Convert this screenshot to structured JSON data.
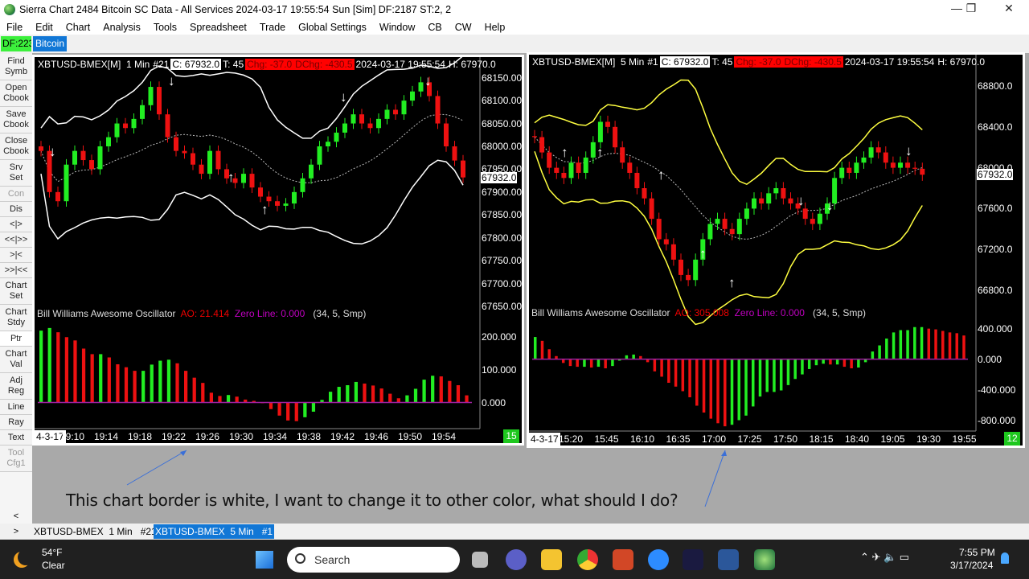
{
  "window": {
    "title": "Sierra Chart 2484 Bitcoin  SC Data - All Services 2024-03-17  19:55:54 Sun [Sim]  DF:2187  ST:2, 2",
    "minimize": "—",
    "restore": "❐",
    "close": "✕"
  },
  "menu": [
    "File",
    "Edit",
    "Chart",
    "Analysis",
    "Tools",
    "Spreadsheet",
    "Trade",
    "Global Settings",
    "Window",
    "CB",
    "CW",
    "Help"
  ],
  "tabs_row": {
    "df": "DF:223",
    "page": "Bitcoin"
  },
  "toolbar": [
    {
      "l1": "Find",
      "l2": "Symb"
    },
    {
      "l1": "Open",
      "l2": "Cbook"
    },
    {
      "l1": "Save",
      "l2": "Cbook"
    },
    {
      "l1": "Close",
      "l2": "Cbook"
    },
    {
      "l1": "Srv",
      "l2": "Set"
    },
    {
      "l1": "Con",
      "l2": ""
    },
    {
      "l1": "Dis",
      "l2": ""
    },
    {
      "l1": "<|>",
      "l2": ""
    },
    {
      "l1": "<<|>>",
      "l2": ""
    },
    {
      "l1": ">|<",
      "l2": ""
    },
    {
      "l1": ">>|<<",
      "l2": ""
    },
    {
      "l1": "Chart",
      "l2": "Set"
    },
    {
      "l1": "Chart",
      "l2": "Stdy"
    },
    {
      "l1": "Ptr",
      "l2": ""
    },
    {
      "l1": "Chart",
      "l2": "Val"
    },
    {
      "l1": "Adj",
      "l2": "Reg"
    },
    {
      "l1": "Line",
      "l2": ""
    },
    {
      "l1": "Ray",
      "l2": ""
    },
    {
      "l1": "Text",
      "l2": ""
    },
    {
      "l1": "Tool",
      "l2": "Cfg1"
    },
    {
      "l1": "<",
      "l2": ""
    },
    {
      "l1": ">",
      "l2": ""
    }
  ],
  "charts": [
    {
      "symbol": "XBTUSD-BMEX[M]  1 Min",
      "num": "#21",
      "close": "C: 67932.0",
      "ticks": "T: 45",
      "chg": "Chg: -37.0",
      "dchg": "DChg: -430.5",
      "datetime": "2024-03-17 19:55:54",
      "high": "H: 67970.0",
      "price_labels": [
        "68150.00",
        "68100.00",
        "68050.00",
        "68000.00",
        "67950.00",
        "67900.00",
        "67850.00",
        "67800.00",
        "67750.00",
        "67700.00",
        "67650.00"
      ],
      "price_ticks": [
        68150,
        68100,
        68050,
        68000,
        67950,
        67900,
        67850,
        67800,
        67750,
        67700,
        67650
      ],
      "price_range": [
        67650,
        68160
      ],
      "last_price": "67932.0",
      "band_color": "#ffffff",
      "closes": [
        67990,
        67900,
        67880,
        67960,
        67990,
        67970,
        67950,
        68000,
        68020,
        68050,
        68040,
        68060,
        68090,
        68130,
        68070,
        68020,
        67990,
        67985,
        67960,
        67940,
        67990,
        67950,
        67930,
        67920,
        67940,
        67910,
        67890,
        67880,
        67870,
        67875,
        67900,
        67930,
        67960,
        68000,
        68010,
        68030,
        68050,
        68070,
        68050,
        68040,
        68060,
        68080,
        68070,
        68100,
        68120,
        68140,
        68110,
        68050,
        68000,
        67969,
        67932
      ],
      "study": {
        "name": "Bill Williams Awesome Oscillator",
        "ao": "AO: 21.414",
        "zero": "Zero Line: 0.000",
        "params": "(34, 5, Smp)",
        "labels": [
          "200.000",
          "100.000",
          "0.000"
        ],
        "ticks": [
          200,
          100,
          0
        ],
        "range": [
          -70,
          240
        ],
        "values": [
          220,
          228,
          215,
          200,
          190,
          165,
          148,
          148,
          138,
          117,
          108,
          97,
          97,
          116,
          128,
          131,
          120,
          97,
          76,
          60,
          30,
          20,
          23,
          18,
          9,
          5,
          -2,
          -20,
          -40,
          -55,
          -57,
          -45,
          -28,
          8,
          33,
          48,
          53,
          63,
          58,
          52,
          43,
          27,
          13,
          22,
          42,
          70,
          82,
          80,
          66,
          53,
          22
        ]
      },
      "time_labels": [
        "19:10",
        "19:14",
        "19:18",
        "19:22",
        "19:26",
        "19:30",
        "19:34",
        "19:38",
        "19:42",
        "19:46",
        "19:50",
        "19:54"
      ],
      "date_label": "4-3-17",
      "badge": "15"
    },
    {
      "symbol": "XBTUSD-BMEX[M]  5 Min",
      "num": "#1",
      "close": "C: 67932.0",
      "ticks": "T: 45",
      "chg": "Chg: -37.0",
      "dchg": "DChg: -430.5",
      "datetime": "2024-03-17 19:55:54",
      "high": "H: 67970.0",
      "price_labels": [
        "68800.0",
        "68400.0",
        "68000.0",
        "67600.0",
        "67200.0",
        "66800.0"
      ],
      "price_ticks": [
        68800,
        68400,
        68000,
        67600,
        67200,
        66800
      ],
      "price_range": [
        66650,
        68950
      ],
      "last_price": "67932.0",
      "band_color": "#ffff40",
      "closes": [
        68300,
        68150,
        68000,
        67950,
        67900,
        68050,
        67950,
        68100,
        68250,
        68450,
        68400,
        68200,
        68050,
        67950,
        67800,
        67700,
        67500,
        67300,
        67250,
        67100,
        66950,
        66900,
        67100,
        67300,
        67450,
        67500,
        67400,
        67350,
        67500,
        67600,
        67700,
        67650,
        67750,
        67800,
        67700,
        67650,
        67600,
        67500,
        67450,
        67550,
        67650,
        67900,
        68000,
        67950,
        68050,
        68100,
        68200,
        68150,
        68050,
        68000,
        68050,
        68000,
        67990,
        67932
      ],
      "study": {
        "name": "Bill Williams Awesome Oscillator",
        "ao": "AO: 305.008",
        "zero": "Zero Line: 0.000",
        "params": "(34, 5, Smp)",
        "labels": [
          "400.000",
          "0.000",
          "-400.000",
          "-800.000"
        ],
        "ticks": [
          400,
          0,
          -400,
          -800
        ],
        "range": [
          -900,
          470
        ],
        "values": [
          290,
          240,
          130,
          40,
          -50,
          -90,
          -100,
          -100,
          -110,
          -100,
          -120,
          -90,
          -20,
          50,
          60,
          40,
          -40,
          -160,
          -230,
          -310,
          -360,
          -420,
          -500,
          -610,
          -700,
          -780,
          -840,
          -880,
          -860,
          -800,
          -740,
          -620,
          -490,
          -430,
          -430,
          -410,
          -340,
          -260,
          -200,
          -130,
          -80,
          -60,
          -70,
          -70,
          -100,
          -120,
          -110,
          -40,
          100,
          180,
          270,
          350,
          380,
          380,
          420,
          420,
          400,
          390,
          370,
          350,
          340,
          310
        ]
      },
      "time_labels": [
        "15:20",
        "15:45",
        "16:10",
        "16:35",
        "17:00",
        "17:25",
        "17:50",
        "18:15",
        "18:40",
        "19:05",
        "19:30",
        "19:55"
      ],
      "date_label": "4-3-17",
      "badge": "12"
    }
  ],
  "annotation": "This chart border is white, I want to change it to other color, what should I do?",
  "bottom_tabs": [
    {
      "label": "XBTUSD-BMEX  1 Min   #21"
    },
    {
      "label": "XBTUSD-BMEX  5 Min   #1"
    }
  ],
  "bottom_arrows": {
    "left": "<",
    "right": ">"
  },
  "taskbar": {
    "temp": "54°F",
    "weather": "Clear",
    "search": "Search",
    "time": "7:55 PM",
    "date": "3/17/2024"
  },
  "colors": {
    "up": "#22ee22",
    "down": "#ee1111",
    "zero_line": "#a020a0",
    "workspace": "#a9a9a9",
    "accent": "#1177d6"
  }
}
